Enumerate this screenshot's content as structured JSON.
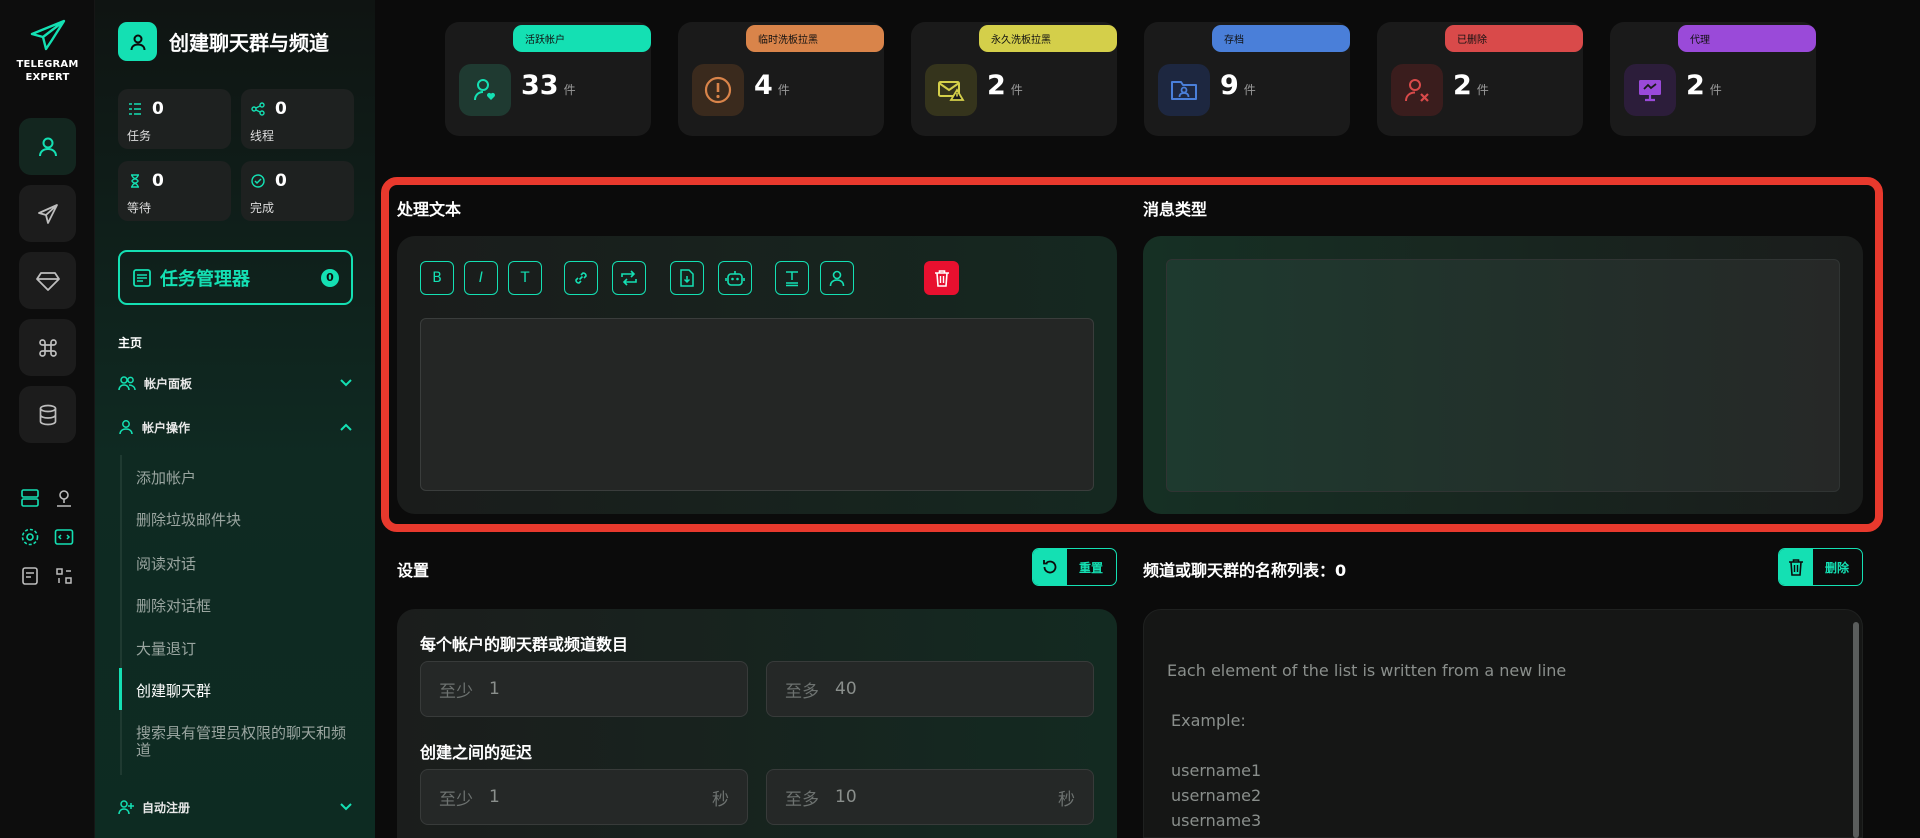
{
  "app": {
    "logo_line1": "TELEGRAM",
    "logo_line2": "EXPERT"
  },
  "sidebar": {
    "title": "创建聊天群与频道",
    "stats": [
      {
        "value": "0",
        "label": "任务",
        "icon": "list-icon"
      },
      {
        "value": "0",
        "label": "线程",
        "icon": "share-icon"
      },
      {
        "value": "0",
        "label": "等待",
        "icon": "hourglass-icon"
      },
      {
        "value": "0",
        "label": "完成",
        "icon": "check-circle-icon"
      }
    ],
    "task_manager": {
      "label": "任务管理器",
      "badge": "0"
    },
    "home_label": "主页",
    "menu": {
      "account_panel": "帐户面板",
      "account_ops": "帐户操作",
      "auto_register": "自动注册"
    },
    "submenu": [
      "添加帐户",
      "删除垃圾邮件块",
      "阅读对话",
      "删除对话框",
      "大量退订",
      "创建聊天群",
      "搜索具有管理员权限的聊天和频道"
    ],
    "active_submenu_index": 5
  },
  "top_stats": [
    {
      "label": "活跃帐户",
      "value": "33",
      "unit": "件",
      "color": "#14e0b3",
      "icon": "user-heart-icon"
    },
    {
      "label": "临时洗板拉黑",
      "value": "4",
      "unit": "件",
      "color": "#d9844a",
      "icon": "alert-circle-icon"
    },
    {
      "label": "永久洗板拉黑",
      "value": "2",
      "unit": "件",
      "color": "#d4cf4a",
      "icon": "mail-warning-icon"
    },
    {
      "label": "存档",
      "value": "9",
      "unit": "件",
      "color": "#4a7fd9",
      "icon": "folder-user-icon"
    },
    {
      "label": "已删除",
      "value": "2",
      "unit": "件",
      "color": "#d94a4a",
      "icon": "user-x-icon"
    },
    {
      "label": "代理",
      "value": "2",
      "unit": "件",
      "color": "#9a4ad9",
      "icon": "proxy-monitor-icon"
    }
  ],
  "editor": {
    "title": "处理文本",
    "toolbar": [
      "B",
      "I",
      "T"
    ],
    "message_type_title": "消息类型"
  },
  "settings": {
    "title": "设置",
    "reset_label": "重置",
    "per_account_label": "每个帐户的聊天群或频道数目",
    "min_placeholder": "至少",
    "min_value": "1",
    "max_placeholder": "至多",
    "max_value": "40",
    "delay_label": "创建之间的延迟",
    "delay_min_value": "1",
    "delay_max_value": "10",
    "delay_unit": "秒"
  },
  "names_list": {
    "title": "频道或聊天群的名称列表：0",
    "delete_label": "删除",
    "hint": "Each element of the list is written from a new line",
    "example_label": "Example:",
    "examples": [
      "username1",
      "username2",
      "username3"
    ]
  },
  "colors": {
    "accent": "#14e0b3",
    "highlight_frame": "#e8392d",
    "delete": "#e8102f"
  }
}
